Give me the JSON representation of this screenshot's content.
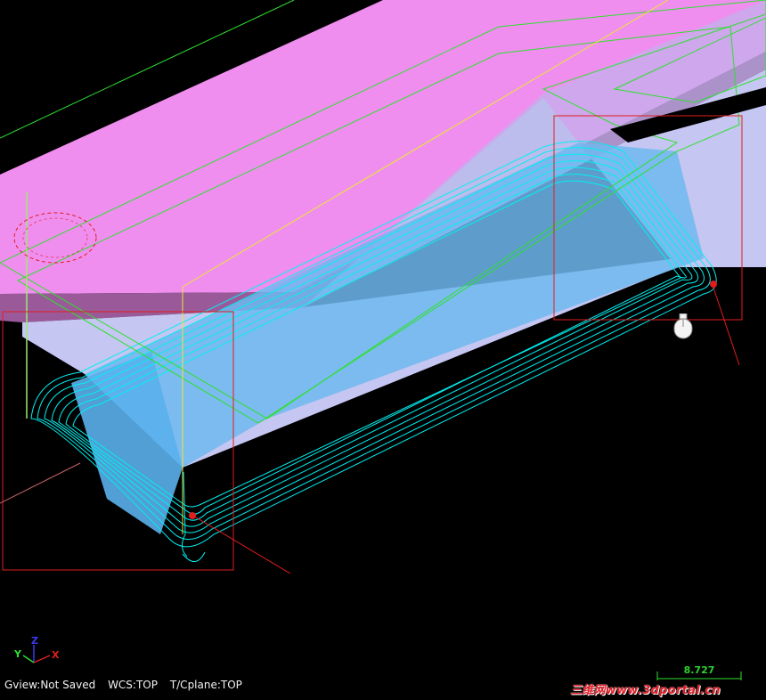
{
  "status": {
    "gview": "Gview:Not Saved",
    "wcs": "WCS:TOP",
    "cplane": "T/Cplane:TOP"
  },
  "axes": {
    "y": "Y",
    "z": "Z",
    "x": "X"
  },
  "scale": {
    "value": "8.727"
  },
  "watermark": {
    "text": "三维网www.3dportal.cn"
  },
  "colors": {
    "background": "#000000",
    "stock_top": "#f08ef0",
    "stock_side": "#9a5a9a",
    "part_face": "#c7c7f4",
    "part_shade": "#7fb6ec",
    "toolpath": "#00f0f0",
    "boundary": "#2ee02e",
    "selection": "#e01e1e",
    "construction": "#e8e830"
  },
  "icons": {
    "cursor": "mouse-cursor-icon",
    "triad": "axis-triad-icon"
  }
}
